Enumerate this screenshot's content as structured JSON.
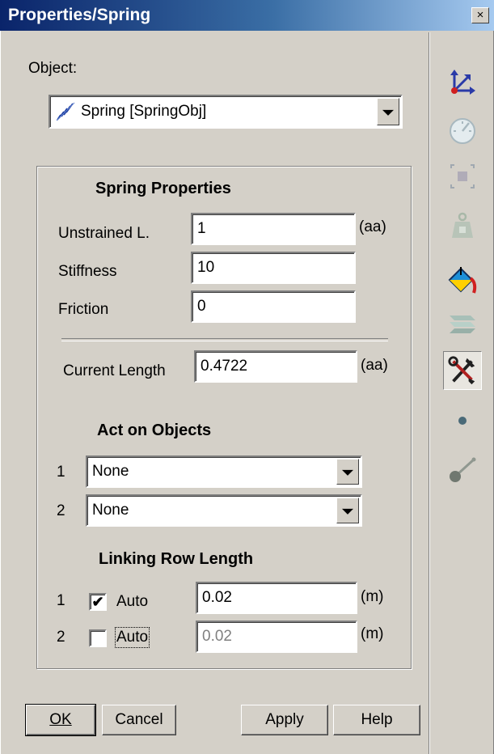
{
  "window": {
    "title": "Properties/Spring",
    "close_label": "×"
  },
  "object": {
    "label": "Object:",
    "selected": "Spring   [SpringObj]",
    "icon": "spring-icon"
  },
  "spring_properties": {
    "heading": "Spring Properties",
    "unstrained_label": "Unstrained L.",
    "unstrained_value": "1",
    "unstrained_unit": "(aa)",
    "stiffness_label": "Stiffness",
    "stiffness_value": "10",
    "friction_label": "Friction",
    "friction_value": "0",
    "current_length_label": "Current Length",
    "current_length_value": "0.4722",
    "current_length_unit": "(aa)"
  },
  "act_on_objects": {
    "heading": "Act on Objects",
    "rows": [
      {
        "index": "1",
        "value": "None"
      },
      {
        "index": "2",
        "value": "None"
      }
    ]
  },
  "linking_row_length": {
    "heading": "Linking Row Length",
    "rows": [
      {
        "index": "1",
        "checked": true,
        "check_mark": "✔",
        "auto_label": "Auto",
        "value": "0.02",
        "unit": "(m)",
        "enabled": true
      },
      {
        "index": "2",
        "checked": false,
        "check_mark": "",
        "auto_label": "Auto",
        "value": "0.02",
        "unit": "(m)",
        "enabled": false
      }
    ]
  },
  "buttons": {
    "ok": "OK",
    "cancel": "Cancel",
    "apply": "Apply",
    "help": "Help"
  },
  "toolbar": {
    "tools": [
      "coordinate-axes-icon",
      "gauge-icon",
      "bounding-box-icon",
      "mass-weight-icon",
      "paint-bucket-icon",
      "layers-icon",
      "tools-wrench-icon",
      "point-icon",
      "link-rod-icon"
    ],
    "pressed": "tools-wrench-icon"
  },
  "colors": {
    "title_start": "#0a246a",
    "title_end": "#a6caf0",
    "face": "#d4d0c8"
  }
}
